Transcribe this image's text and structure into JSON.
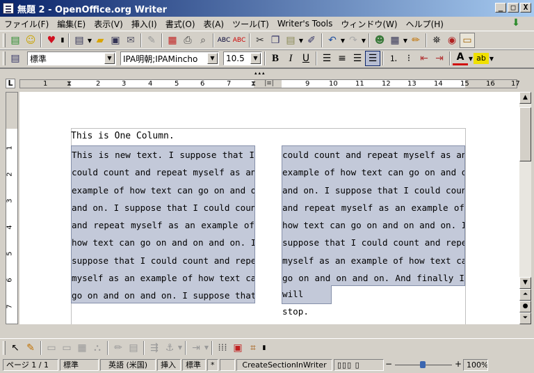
{
  "window": {
    "title": "無題 2 - OpenOffice.org Writer",
    "buttons": {
      "minimize": "_",
      "maximize": "□",
      "close": "X"
    }
  },
  "menu": [
    "ファイル(F)",
    "編集(E)",
    "表示(V)",
    "挿入(I)",
    "書式(O)",
    "表(A)",
    "ツール(T)",
    "Writer's Tools",
    "ウィンドウ(W)",
    "ヘルプ(H)"
  ],
  "formatting": {
    "style": "標準",
    "font": "IPA明朝;IPAMincho",
    "size": "10.5",
    "bold": "B",
    "italic": "I",
    "underline": "U",
    "font_color_letter": "A",
    "highlight_letter": "ab"
  },
  "ruler": {
    "numbers": [
      "1",
      "2",
      "3",
      "4",
      "5",
      "6",
      "7",
      "9",
      "10",
      "11",
      "12",
      "13",
      "14",
      "15",
      "16",
      "17"
    ]
  },
  "vruler": {
    "numbers": [
      "1",
      "2",
      "3",
      "4",
      "5",
      "6",
      "7"
    ]
  },
  "document": {
    "one_column_text": "This is One Column.",
    "column1_lines": [
      "This is new text. I suppose that I",
      "could count and repeat myself as an",
      "example of how text can go on and on",
      "and on. I suppose that I could count",
      "and repeat myself as an example of",
      "how text can go on and on and on. I",
      "suppose that I could count and repeat",
      "myself as an example of how text can",
      "go on and on and on. I suppose that I"
    ],
    "column2_lines": [
      "could count and repeat myself as an",
      "example of how text can go on and on",
      "and on. I suppose that I could count",
      "and repeat myself as an example of",
      "how text can go on and on and on. I",
      "suppose that I could count and repeat",
      "myself as an example of how text can",
      "go on and on and on. And finally I"
    ],
    "column2_last": "will stop."
  },
  "status": {
    "page": "ページ 1 / 1",
    "style": "標準",
    "language": "英語 (米国)",
    "insert_mode": "挿入",
    "selection_mode": "標準",
    "modified": "*",
    "section": "CreateSectionInWriter",
    "zoom": "100%",
    "zoom_minus": "−",
    "zoom_plus": "+"
  },
  "icons": {
    "new": "document-new-icon",
    "smiley": "smiley-icon",
    "heart": "heart-icon",
    "open": "folder-open-icon",
    "save": "save-icon",
    "email": "email-icon",
    "edit": "edit-icon",
    "pdf": "pdf-icon",
    "print": "print-icon",
    "preview": "print-preview-icon",
    "spellcheck": "spellcheck-icon",
    "autospell": "auto-spellcheck-icon",
    "cut": "cut-icon",
    "copy": "copy-icon",
    "paste": "paste-icon",
    "format_paint": "clone-formatting-icon",
    "undo": "undo-icon",
    "redo": "redo-icon",
    "gallery": "gallery-icon",
    "table": "table-icon",
    "draw": "show-draw-functions-icon",
    "find": "find-icon",
    "navigator": "navigator-icon",
    "datasource": "data-sources-icon"
  }
}
